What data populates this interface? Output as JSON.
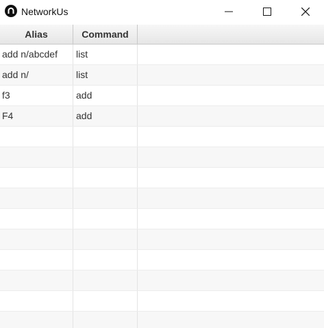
{
  "window": {
    "title": "NetworkUs",
    "icon": "networkus-logo-icon",
    "controls": [
      "minimize-icon",
      "maximize-icon",
      "close-icon"
    ]
  },
  "table": {
    "columns": [
      "Alias",
      "Command"
    ],
    "rows": [
      {
        "alias": "add n/abcdef",
        "command": "list"
      },
      {
        "alias": "add n/",
        "command": "list"
      },
      {
        "alias": "f3",
        "command": "add"
      },
      {
        "alias": "F4",
        "command": "add"
      },
      {
        "alias": "",
        "command": ""
      },
      {
        "alias": "",
        "command": ""
      },
      {
        "alias": "",
        "command": ""
      },
      {
        "alias": "",
        "command": ""
      },
      {
        "alias": "",
        "command": ""
      },
      {
        "alias": "",
        "command": ""
      },
      {
        "alias": "",
        "command": ""
      },
      {
        "alias": "",
        "command": ""
      },
      {
        "alias": "",
        "command": ""
      },
      {
        "alias": "",
        "command": ""
      }
    ]
  },
  "colors": {
    "row_alt": "#f7f7f7",
    "header_top": "#f7f7f7",
    "header_bottom": "#e6e6e6",
    "text": "#333333"
  }
}
